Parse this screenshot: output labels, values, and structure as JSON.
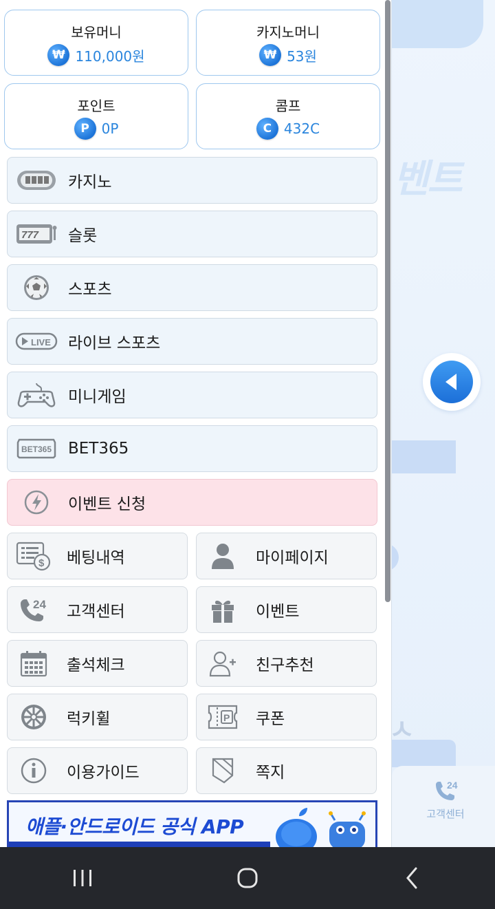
{
  "wallet": {
    "holding_money": {
      "label": "보유머니",
      "value": "110,000원",
      "icon": "won-coin-icon",
      "symbol": "₩"
    },
    "casino_money": {
      "label": "카지노머니",
      "value": "53원",
      "icon": "won-coin-icon",
      "symbol": "₩"
    },
    "points": {
      "label": "포인트",
      "value": "0P",
      "icon": "point-coin-icon",
      "symbol": "P"
    },
    "comp": {
      "label": "콤프",
      "value": "432C",
      "icon": "comp-coin-icon",
      "symbol": "C"
    }
  },
  "menu": [
    {
      "label": "카지노",
      "icon": "casino-table-icon"
    },
    {
      "label": "슬롯",
      "icon": "slot-machine-icon"
    },
    {
      "label": "스포츠",
      "icon": "soccer-ball-icon"
    },
    {
      "label": "라이브 스포츠",
      "icon": "live-badge-icon"
    },
    {
      "label": "미니게임",
      "icon": "gamepad-icon"
    },
    {
      "label": "BET365",
      "icon": "bet365-icon"
    },
    {
      "label": "이벤트 신청",
      "icon": "lightning-icon"
    }
  ],
  "grid": [
    {
      "label": "베팅내역",
      "icon": "betting-history-icon"
    },
    {
      "label": "마이페이지",
      "icon": "user-icon"
    },
    {
      "label": "고객센터",
      "icon": "phone-24-icon"
    },
    {
      "label": "이벤트",
      "icon": "gift-icon"
    },
    {
      "label": "출석체크",
      "icon": "calendar-icon"
    },
    {
      "label": "친구추천",
      "icon": "add-friend-icon"
    },
    {
      "label": "럭키휠",
      "icon": "lucky-wheel-icon"
    },
    {
      "label": "쿠폰",
      "icon": "coupon-icon"
    },
    {
      "label": "이용가이드",
      "icon": "info-icon"
    },
    {
      "label": "쪽지",
      "icon": "message-icon"
    }
  ],
  "banner": {
    "text": "애플·안드로이드 공식 APP"
  },
  "background": {
    "ghost_text": "벤트",
    "support_label": "고객센터",
    "support_badge": "24"
  },
  "colors": {
    "accent": "#2a85dd",
    "card_border": "#9ec7ee",
    "menu_bg": "#eef5fb",
    "event_bg": "#fde2e8",
    "nav_bg": "#25272c"
  }
}
